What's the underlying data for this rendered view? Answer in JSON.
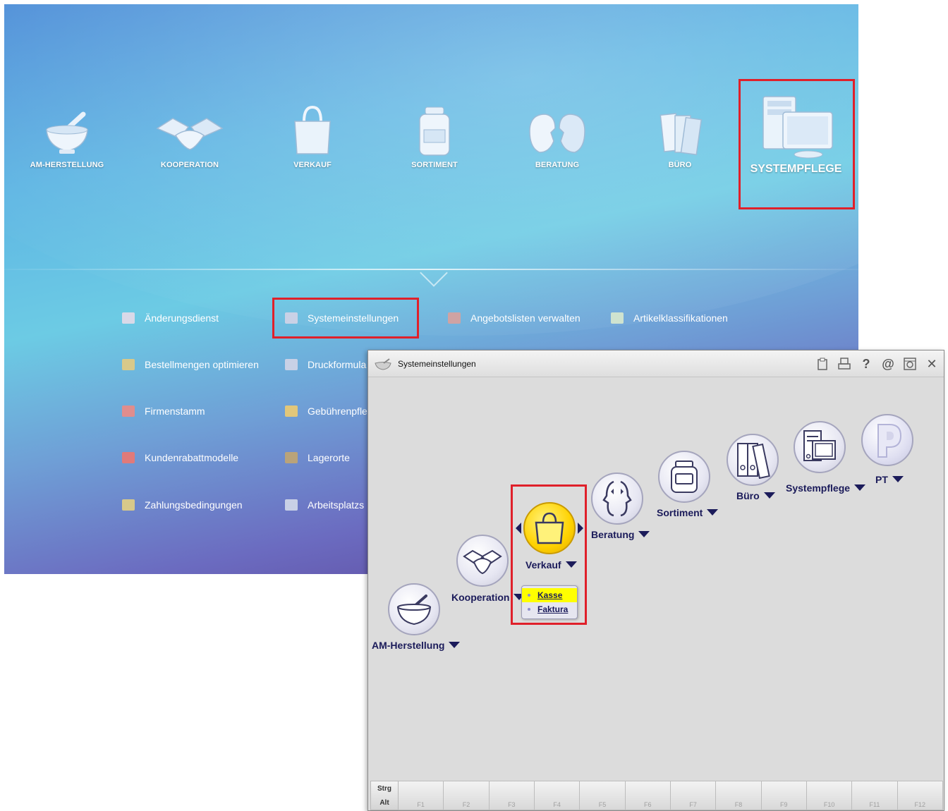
{
  "launcher": {
    "categories": [
      {
        "label": "AM-HERSTELLUNG",
        "icon": "mortar-icon"
      },
      {
        "label": "KOOPERATION",
        "icon": "handshake-icon"
      },
      {
        "label": "VERKAUF",
        "icon": "shopping-bag-icon"
      },
      {
        "label": "SORTIMENT",
        "icon": "medicine-jar-icon"
      },
      {
        "label": "BERATUNG",
        "icon": "consultation-faces-icon"
      },
      {
        "label": "BÜRO",
        "icon": "office-binders-icon"
      },
      {
        "label": "SYSTEMPFLEGE",
        "icon": "computer-icon",
        "selected": true
      }
    ],
    "menu": [
      {
        "label": "Änderungsdienst",
        "icon": "aenderungsdienst-icon"
      },
      {
        "label": "Systemeinstellungen",
        "icon": "systemeinstellungen-icon",
        "highlighted": true
      },
      {
        "label": "Angebotslisten verwalten",
        "icon": "angebotslisten-icon"
      },
      {
        "label": "Artikelklassifikationen",
        "icon": "artikelklassifikationen-icon"
      },
      {
        "label": "Bestellmengen optimieren",
        "icon": "bestellmengen-icon"
      },
      {
        "label": "Druckformula",
        "icon": "druckformulare-icon"
      },
      {
        "label": "Firmenstamm",
        "icon": "firmenstamm-icon"
      },
      {
        "label": "Gebührenpfle",
        "icon": "gebuehrenpflege-icon"
      },
      {
        "label": "Kundenrabattmodelle",
        "icon": "kundenrabatt-icon"
      },
      {
        "label": "Lagerorte",
        "icon": "lagerorte-icon"
      },
      {
        "label": "Zahlungsbedingungen",
        "icon": "zahlungsbedingungen-icon"
      },
      {
        "label": "Arbeitsplatzs",
        "icon": "arbeitsplatz-icon"
      }
    ]
  },
  "dialog": {
    "title": "Systemeinstellungen",
    "title_icons": [
      "clipboard-icon",
      "print-icon",
      "help-icon",
      "email-icon",
      "settings-window-icon",
      "close-icon"
    ],
    "nodes": [
      {
        "label": "AM-Herstellung",
        "icon": "mortar-icon"
      },
      {
        "label": "Kooperation",
        "icon": "handshake-icon"
      },
      {
        "label": "Verkauf",
        "icon": "shopping-bag-icon",
        "selected": true
      },
      {
        "label": "Beratung",
        "icon": "consultation-faces-icon"
      },
      {
        "label": "Sortiment",
        "icon": "medicine-jar-icon"
      },
      {
        "label": "Büro",
        "icon": "office-binders-icon"
      },
      {
        "label": "Systempflege",
        "icon": "computer-icon"
      },
      {
        "label": "PT",
        "icon": "pt-logo-icon"
      }
    ],
    "submenu": [
      {
        "label": "Kasse",
        "active": true
      },
      {
        "label": "Faktura",
        "active": false
      }
    ],
    "fkeys": {
      "modifiers": [
        "Strg",
        "Alt"
      ],
      "keys": [
        "F1",
        "F2",
        "F3",
        "F4",
        "F5",
        "F6",
        "F7",
        "F8",
        "F9",
        "F10",
        "F11",
        "F12"
      ]
    }
  },
  "colors": {
    "highlight": "#e0202a",
    "dialog_text": "#1b1b5a",
    "selected_node": "#ffd200",
    "submenu_active": "#ffff00"
  }
}
